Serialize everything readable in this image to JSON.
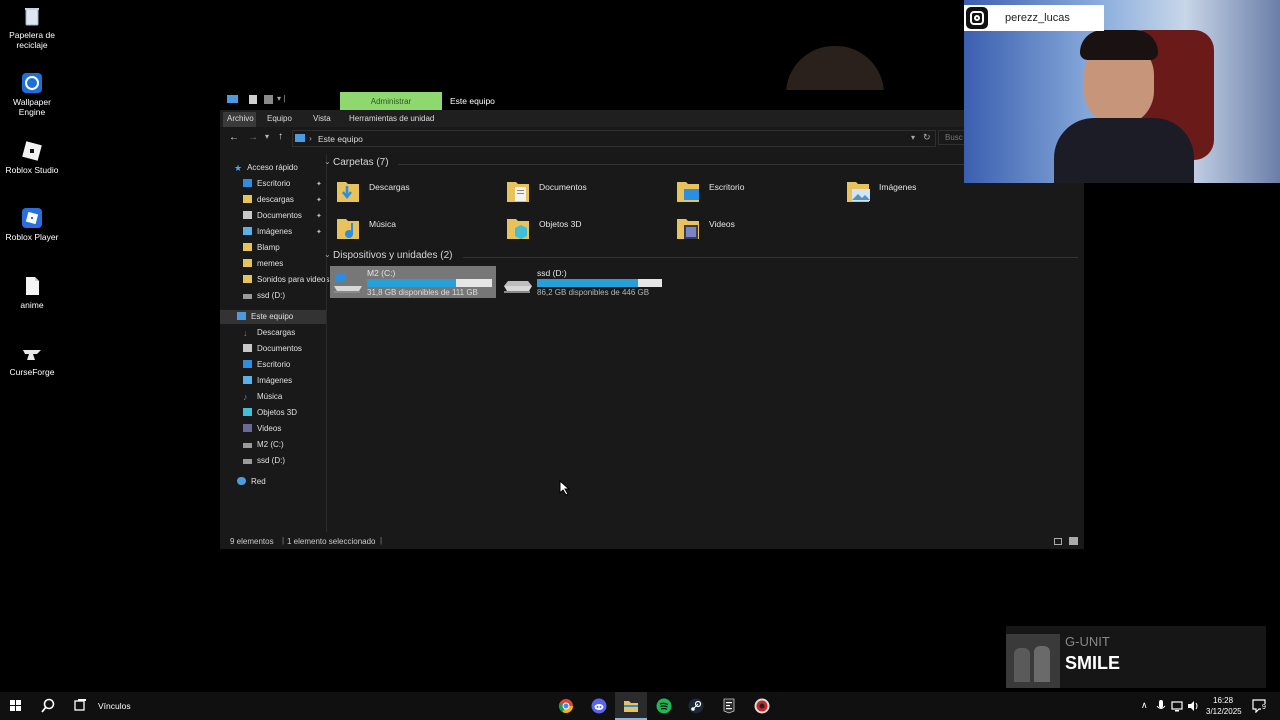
{
  "desktop": {
    "icons": [
      {
        "label": "Papelera de reciclaje",
        "icon": "recycle-bin-icon"
      },
      {
        "label": "Wallpaper Engine",
        "icon": "wallpaper-engine-icon"
      },
      {
        "label": "Roblox Studio",
        "icon": "roblox-studio-icon"
      },
      {
        "label": "Roblox Player",
        "icon": "roblox-player-icon"
      },
      {
        "label": "anime",
        "icon": "file-icon"
      },
      {
        "label": "CurseForge",
        "icon": "curseforge-icon"
      }
    ]
  },
  "explorer": {
    "title": "Este equipo",
    "context_tab": "Administrar",
    "ribbon_tabs": [
      "Archivo",
      "Equipo",
      "Vista",
      "Herramientas de unidad"
    ],
    "address": "Este equipo",
    "search_placeholder": "Busc",
    "nav": {
      "quick_access": "Acceso rápido",
      "quick_items": [
        "Escritorio",
        "descargas",
        "Documentos",
        "Imágenes",
        "Blamp",
        "memes",
        "Sonidos para videos",
        "ssd (D:)"
      ],
      "this_pc": "Este equipo",
      "pc_items": [
        "Descargas",
        "Documentos",
        "Escritorio",
        "Imágenes",
        "Música",
        "Objetos 3D",
        "Videos",
        "M2 (C:)",
        "ssd (D:)"
      ],
      "network": "Red"
    },
    "folders_header": "Carpetas (7)",
    "folders": [
      "Descargas",
      "Documentos",
      "Escritorio",
      "Imágenes",
      "Música",
      "Objetos 3D",
      "Videos"
    ],
    "devices_header": "Dispositivos y unidades (2)",
    "drives": [
      {
        "name": "M2 (C:)",
        "info": "31,8 GB disponibles de 111 GB",
        "used_fraction": 0.71,
        "selected": true
      },
      {
        "name": "ssd (D:)",
        "info": "86,2 GB disponibles de 446 GB",
        "used_fraction": 0.81,
        "selected": false
      }
    ],
    "status": {
      "count": "9 elementos",
      "selected": "1 elemento seleccionado"
    }
  },
  "overlay": {
    "instagram_user": "perezz_lucas",
    "song_artist": "G-UNIT",
    "song_title": "SMILE"
  },
  "taskbar": {
    "links_label": "Vínculos",
    "time": "16:28",
    "date": "3/12/2025",
    "notification_count": "9",
    "accent": "#26a0da"
  }
}
